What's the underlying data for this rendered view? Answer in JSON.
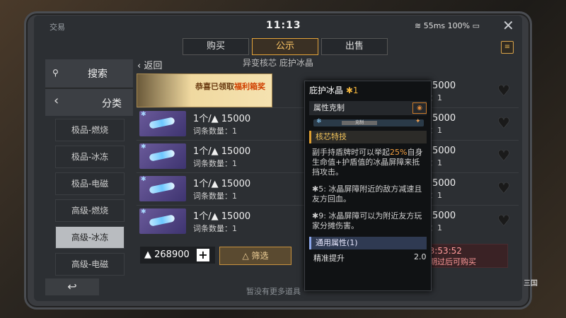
{
  "status": {
    "title": "交易",
    "time": "11:13",
    "network": "55ms",
    "battery": "100%"
  },
  "tabs": [
    {
      "label": "购买"
    },
    {
      "label": "公示"
    },
    {
      "label": "出售"
    }
  ],
  "sidebar": {
    "search_label": "搜索",
    "category_label": "分类",
    "items": [
      {
        "label": "极品-燃烧"
      },
      {
        "label": "极品-冰冻"
      },
      {
        "label": "极品-电磁"
      },
      {
        "label": "高级-燃烧"
      },
      {
        "label": "高级-冰冻"
      },
      {
        "label": "高级-电磁"
      }
    ]
  },
  "list": {
    "back_label": "返回",
    "header": "异变核芯 庇护冰晶",
    "banner_prefix": "恭喜已领取",
    "banner_highlight": "福利箱奖",
    "rows": [
      {
        "price": "1个/▲ 15000",
        "entries": "词条数量：1"
      },
      {
        "price": "1个/▲ 15000",
        "entries": "词条数量：1"
      },
      {
        "price": "1个/▲ 15000",
        "entries": "词条数量：1"
      },
      {
        "price": "1个/▲ 15000",
        "entries": "词条数量：1"
      },
      {
        "price": "1个/▲ 15000",
        "entries": "词条数量：1"
      }
    ],
    "right_rows": [
      {
        "price": "1个/▲ 15000",
        "entries": "词条数量：1"
      },
      {
        "price": "1个/▲ 15000",
        "entries": "词条数量：1"
      },
      {
        "price": "1个/▲ 15000",
        "entries": "词条数量：1"
      },
      {
        "price": "1个/▲ 15000",
        "entries": "词条数量：1"
      },
      {
        "price": "1个/▲ 15000",
        "entries": "词条数量：1"
      }
    ]
  },
  "footer": {
    "balance": "268900",
    "plus": "+",
    "filter_label": "筛选",
    "timer": "03:53:52",
    "timer_note": "公示期过后可购买",
    "note": "暂没有更多道具"
  },
  "popup": {
    "title": "庇护冰晶",
    "star": "✱1",
    "section_attr": "属性克制",
    "bar_label": "克制",
    "core_label": "核芯特技",
    "desc1_a": "副手持盾牌时可以举起",
    "desc1_hl": "25%",
    "desc1_b": "自身生命值+护盾值的冰晶屏障来抵挡攻击。",
    "desc2": "✱5: 冰晶屏障附近的敌方减速且友方回血。",
    "desc3": "✱9: 冰晶屏障可以为附近友方玩家分摊伤害。",
    "general_label": "通用属性(1)",
    "stat_name": "精准提升",
    "stat_value": "2.0"
  },
  "logo_text": "三国"
}
